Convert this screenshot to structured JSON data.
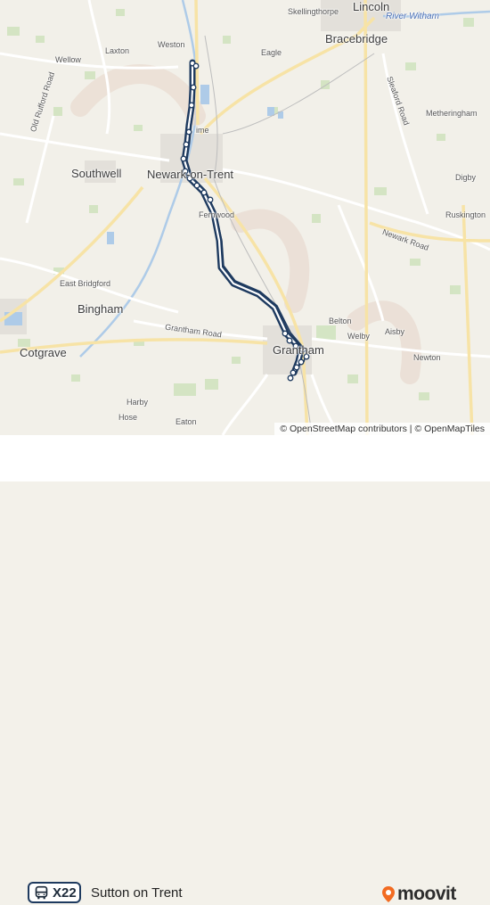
{
  "map": {
    "places": {
      "lincoln": "Lincoln",
      "skellingthorpe": "Skellingthorpe",
      "river_witham": "River Witham",
      "bracebridge": "Bracebridge",
      "weston": "Weston",
      "laxton": "Laxton",
      "wellow": "Wellow",
      "eagle": "Eagle",
      "old_rufford_road": "Old Rufford Road",
      "sleaford_road": "Sleaford Road",
      "metheringham": "Metheringham",
      "holme": "ime",
      "southwell": "Southwell",
      "newark_on_trent": "Newark-on-Trent",
      "digby": "Digby",
      "fernwood": "Fernwood",
      "ruskington": "Ruskington",
      "newark_road": "Newark Road",
      "east_bridgford": "East Bridgford",
      "bingham": "Bingham",
      "belton": "Belton",
      "grantham_road": "Grantham Road",
      "welby": "Welby",
      "aisby": "Aisby",
      "cotgrave": "Cotgrave",
      "grantham": "Grantham",
      "newton": "Newton",
      "harby": "Harby",
      "hose": "Hose",
      "eaton": "Eaton"
    },
    "route": {
      "color": "#1e3a5f"
    },
    "attribution": "© OpenStreetMap contributors | © OpenMapTiles"
  },
  "footer": {
    "route_number": "X22",
    "destination": "Sutton on Trent",
    "icon": "bus-icon",
    "brand": "moovit",
    "brand_color": "#f26b21"
  }
}
